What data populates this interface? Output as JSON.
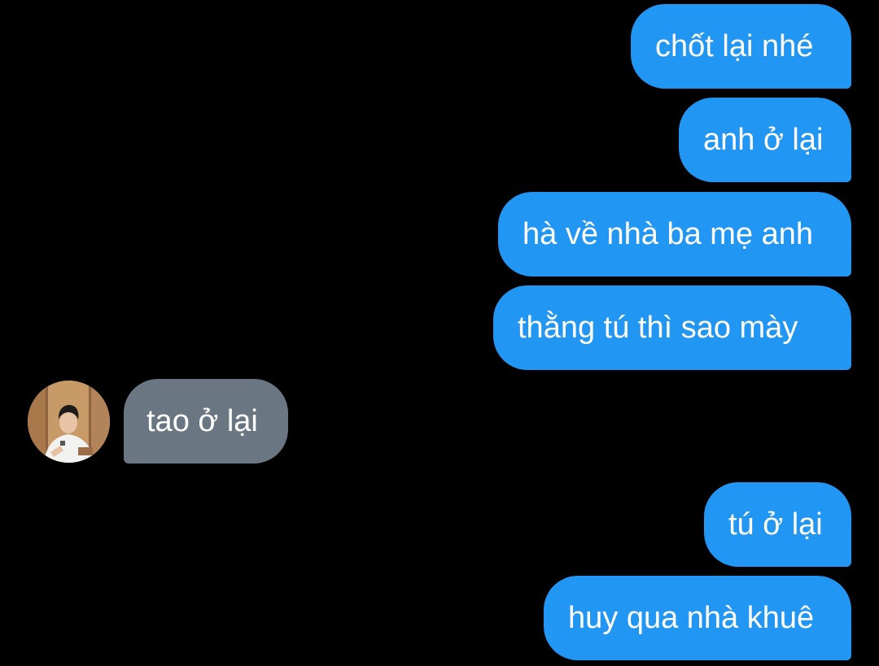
{
  "messages": [
    {
      "sender": "me",
      "text": "chốt lại nhé"
    },
    {
      "sender": "me",
      "text": "anh ở lại"
    },
    {
      "sender": "me",
      "text": "hà về nhà ba mẹ anh"
    },
    {
      "sender": "me",
      "text": "thằng tú thì sao mày"
    },
    {
      "sender": "other",
      "text": "tao ở lại"
    },
    {
      "sender": "me",
      "text": "tú ở lại"
    },
    {
      "sender": "me",
      "text": "huy qua nhà khuê"
    }
  ],
  "colors": {
    "background": "#000000",
    "outgoing_bubble": "#2196f3",
    "incoming_bubble": "#6a7782",
    "text": "#ffffff"
  },
  "avatar": {
    "icon": "contact-avatar-photo"
  }
}
